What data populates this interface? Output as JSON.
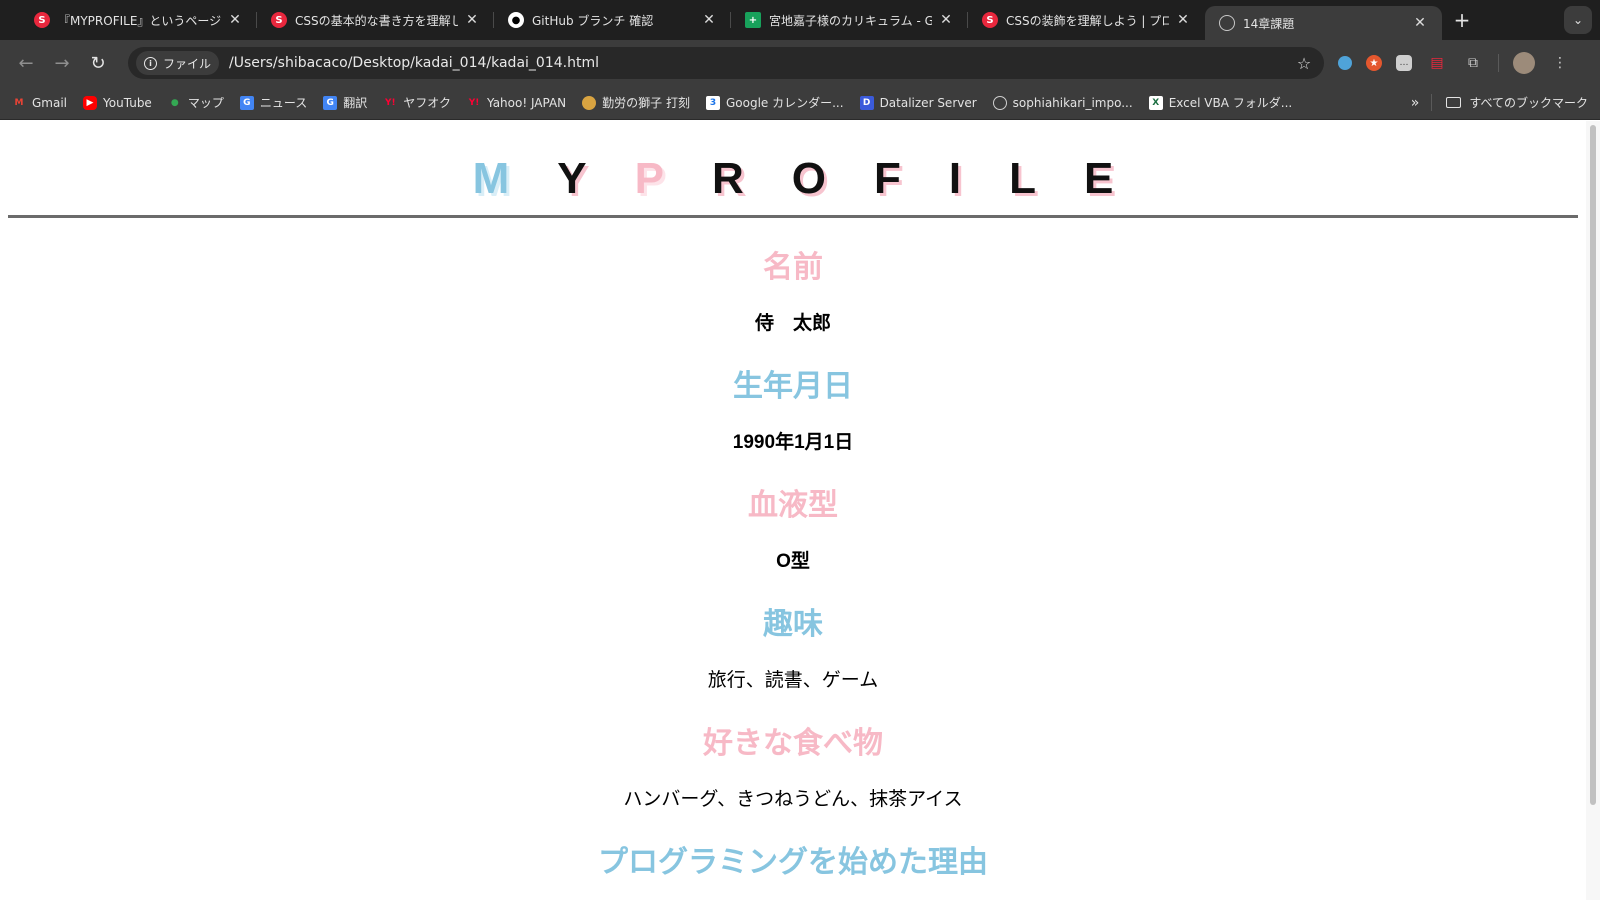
{
  "browser": {
    "tabs": [
      {
        "title": "『MYPROFILE』というページを",
        "icon": "samurai-icon"
      },
      {
        "title": "CSSの基本的な書き方を理解しよ",
        "icon": "samurai-icon"
      },
      {
        "title": "GitHub ブランチ 確認",
        "icon": "github-icon"
      },
      {
        "title": "宮地嘉子様のカリキュラム - Goo",
        "icon": "sheets-icon"
      },
      {
        "title": "CSSの装飾を理解しよう | プログ",
        "icon": "samurai-icon"
      },
      {
        "title": "14章課題",
        "icon": "globe-icon",
        "active": true
      }
    ],
    "address": {
      "chip_label": "ファイル",
      "url": "/Users/shibacaco/Desktop/kadai_014/kadai_014.html"
    },
    "bookmarks": [
      {
        "label": "Gmail",
        "icon": "gmail-icon"
      },
      {
        "label": "YouTube",
        "icon": "youtube-icon"
      },
      {
        "label": "マップ",
        "icon": "maps-icon"
      },
      {
        "label": "ニュース",
        "icon": "news-icon"
      },
      {
        "label": "翻訳",
        "icon": "translate-icon"
      },
      {
        "label": "ヤフオク",
        "icon": "yahoo-icon"
      },
      {
        "label": "Yahoo! JAPAN",
        "icon": "yahoo-icon"
      },
      {
        "label": "勤労の獅子 打刻",
        "icon": "lion-icon"
      },
      {
        "label": "Google カレンダー...",
        "icon": "calendar-icon"
      },
      {
        "label": "Datalizer Server",
        "icon": "datalizer-icon"
      },
      {
        "label": "sophiahikari_impo...",
        "icon": "web-icon"
      },
      {
        "label": "Excel VBA フォルダ...",
        "icon": "excel-icon"
      }
    ],
    "all_bookmarks_label": "すべてのブックマーク"
  },
  "page": {
    "title_letters": [
      "M",
      "Y",
      "P",
      "R",
      "O",
      "F",
      "I",
      "L",
      "E"
    ],
    "sections": [
      {
        "heading": "名前",
        "value": "侍　太郎",
        "heading_color": "pink",
        "value_bold": true
      },
      {
        "heading": "生年月日",
        "value": "1990年1月1日",
        "heading_color": "blue",
        "value_bold": true
      },
      {
        "heading": "血液型",
        "value": "O型",
        "heading_color": "pink",
        "value_bold": true
      },
      {
        "heading": "趣味",
        "value": "旅行、読書、ゲーム",
        "heading_color": "blue",
        "value_bold": false
      },
      {
        "heading": "好きな食べ物",
        "value": "ハンバーグ、きつねうどん、抹茶アイス",
        "heading_color": "pink",
        "value_bold": false
      },
      {
        "heading": "プログラミングを始めた理由",
        "value": "",
        "heading_color": "blue",
        "value_bold": false
      }
    ]
  },
  "colors": {
    "pink": "#f7b9c6",
    "blue": "#87c5e0",
    "chrome_dark": "#1f1f1f",
    "chrome_toolbar": "#3c3c3c"
  }
}
